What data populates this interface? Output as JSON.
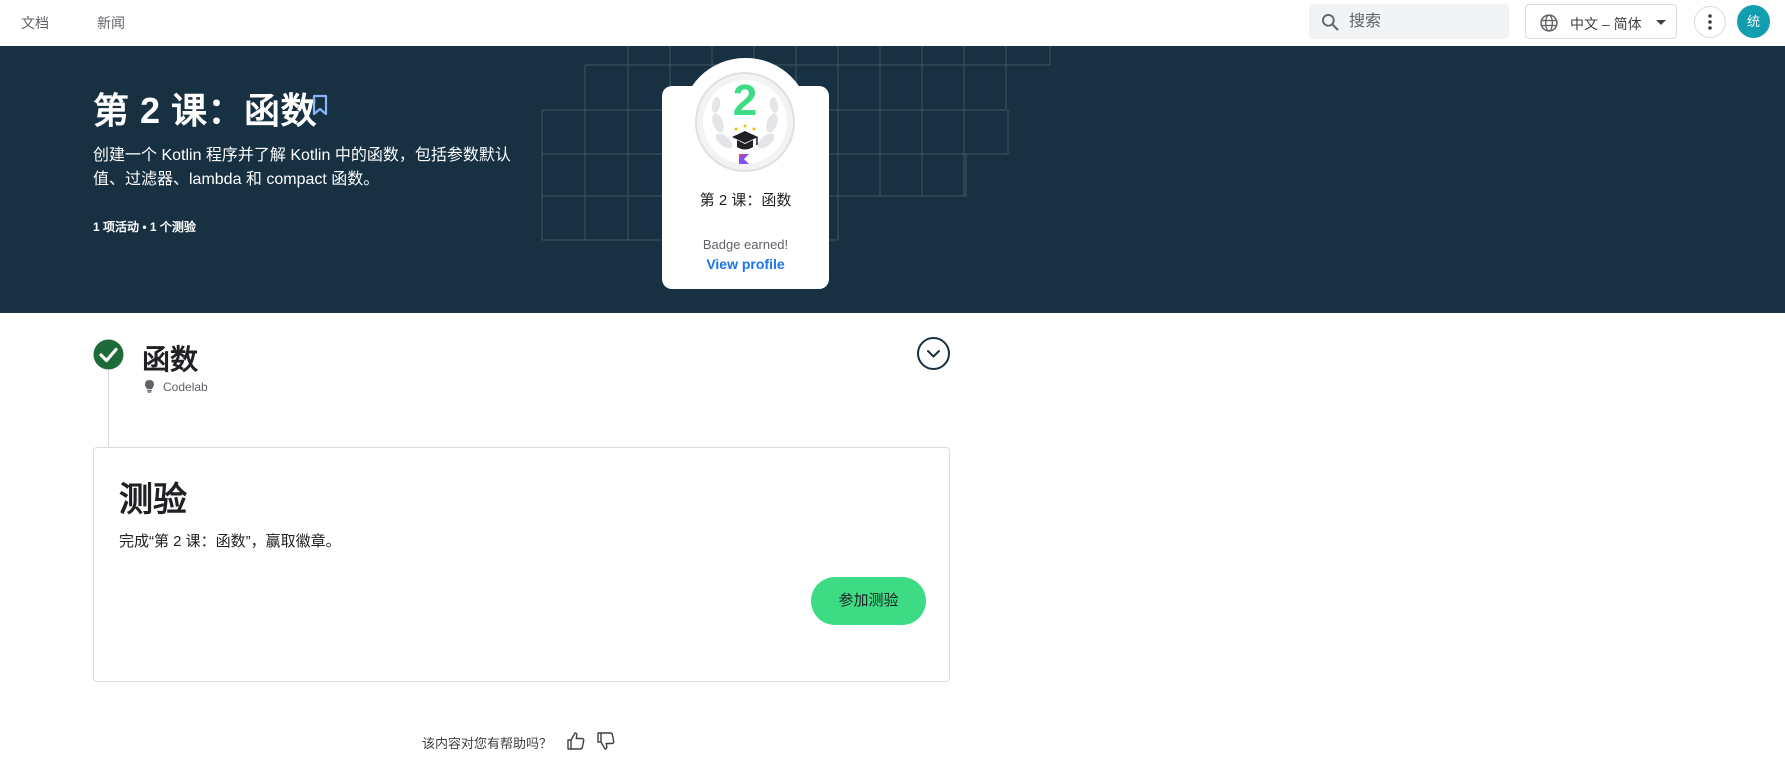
{
  "topbar": {
    "nav": [
      {
        "label": "文档"
      },
      {
        "label": "新闻"
      }
    ],
    "search": {
      "placeholder": "搜索"
    },
    "language": {
      "label": "中文 – 简体"
    },
    "avatar": {
      "initial": "统"
    }
  },
  "hero": {
    "title": "第 2 课：函数",
    "description": "创建一个 Kotlin 程序并了解 Kotlin 中的函数，包括参数默认值、过滤器、lambda 和 compact 函数。",
    "meta": "1 项活动 • 1 个测验"
  },
  "badge": {
    "number": "2",
    "title": "第 2 课：函数",
    "status": "Badge earned!",
    "link": "View profile"
  },
  "activity": {
    "title": "函数",
    "type": "Codelab"
  },
  "quiz": {
    "title": "测验",
    "description": "完成“第 2 课：函数”，赢取徽章。",
    "button": "参加测验"
  },
  "feedback": {
    "question": "该内容对您有帮助吗？"
  },
  "colors": {
    "hero_bg": "#173042",
    "accent_green": "#3ddc84",
    "check_green": "#1e6b3a",
    "link_blue": "#1a73e8",
    "avatar_teal": "#129eaf"
  }
}
